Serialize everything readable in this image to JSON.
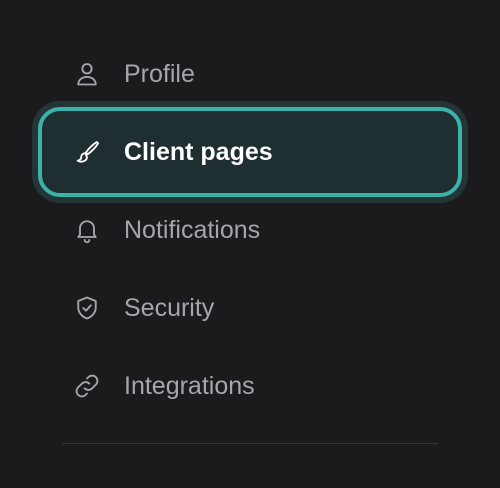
{
  "nav": {
    "items": [
      {
        "label": "Profile",
        "icon": "user-icon",
        "active": false
      },
      {
        "label": "Client pages",
        "icon": "paintbrush-icon",
        "active": true
      },
      {
        "label": "Notifications",
        "icon": "bell-icon",
        "active": false
      },
      {
        "label": "Security",
        "icon": "shield-check-icon",
        "active": false
      },
      {
        "label": "Integrations",
        "icon": "link-icon",
        "active": false
      }
    ]
  },
  "colors": {
    "background": "#1b1b1d",
    "text": "#a5a5ae",
    "active_text": "#ffffff",
    "active_border": "#3bb3a8",
    "active_bg": "#1f2e30"
  }
}
